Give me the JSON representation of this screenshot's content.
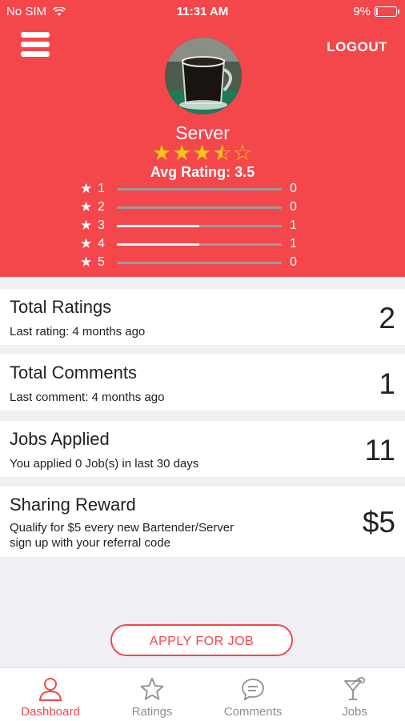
{
  "status": {
    "carrier": "No SIM",
    "time": "11:31 AM",
    "battery": "9%",
    "battery_level": 0.09
  },
  "header": {
    "logout_label": "LOGOUT",
    "name": "Server",
    "rating_stars": 3.5,
    "avg_rating_label": "Avg Rating: 3.5",
    "distribution": [
      {
        "star": "1",
        "count": "0",
        "fraction": 0
      },
      {
        "star": "2",
        "count": "0",
        "fraction": 0
      },
      {
        "star": "3",
        "count": "1",
        "fraction": 0.5
      },
      {
        "star": "4",
        "count": "1",
        "fraction": 0.5
      },
      {
        "star": "5",
        "count": "0",
        "fraction": 0
      }
    ]
  },
  "cards": [
    {
      "title": "Total Ratings",
      "subtitle": "Last rating: 4 months ago",
      "value": "2"
    },
    {
      "title": "Total Comments",
      "subtitle": "Last comment: 4 months ago",
      "value": "1"
    },
    {
      "title": "Jobs Applied",
      "subtitle": "You applied 0 Job(s) in last 30 days",
      "value": "11"
    },
    {
      "title": "Sharing Reward",
      "subtitle_line1": "Qualify for $5 every new Bartender/Server",
      "subtitle_line2": "sign up with your referral code",
      "value": "$5"
    }
  ],
  "apply_button_label": "APPLY FOR JOB",
  "tabs": [
    {
      "label": "Dashboard",
      "icon": "user-icon",
      "active": true
    },
    {
      "label": "Ratings",
      "icon": "star-icon",
      "active": false
    },
    {
      "label": "Comments",
      "icon": "chat-bubble-icon",
      "active": false
    },
    {
      "label": "Jobs",
      "icon": "cocktail-glass-icon",
      "active": false
    }
  ],
  "colors": {
    "accent": "#f4474b",
    "star": "#f6c21c",
    "background": "#efeff4"
  }
}
